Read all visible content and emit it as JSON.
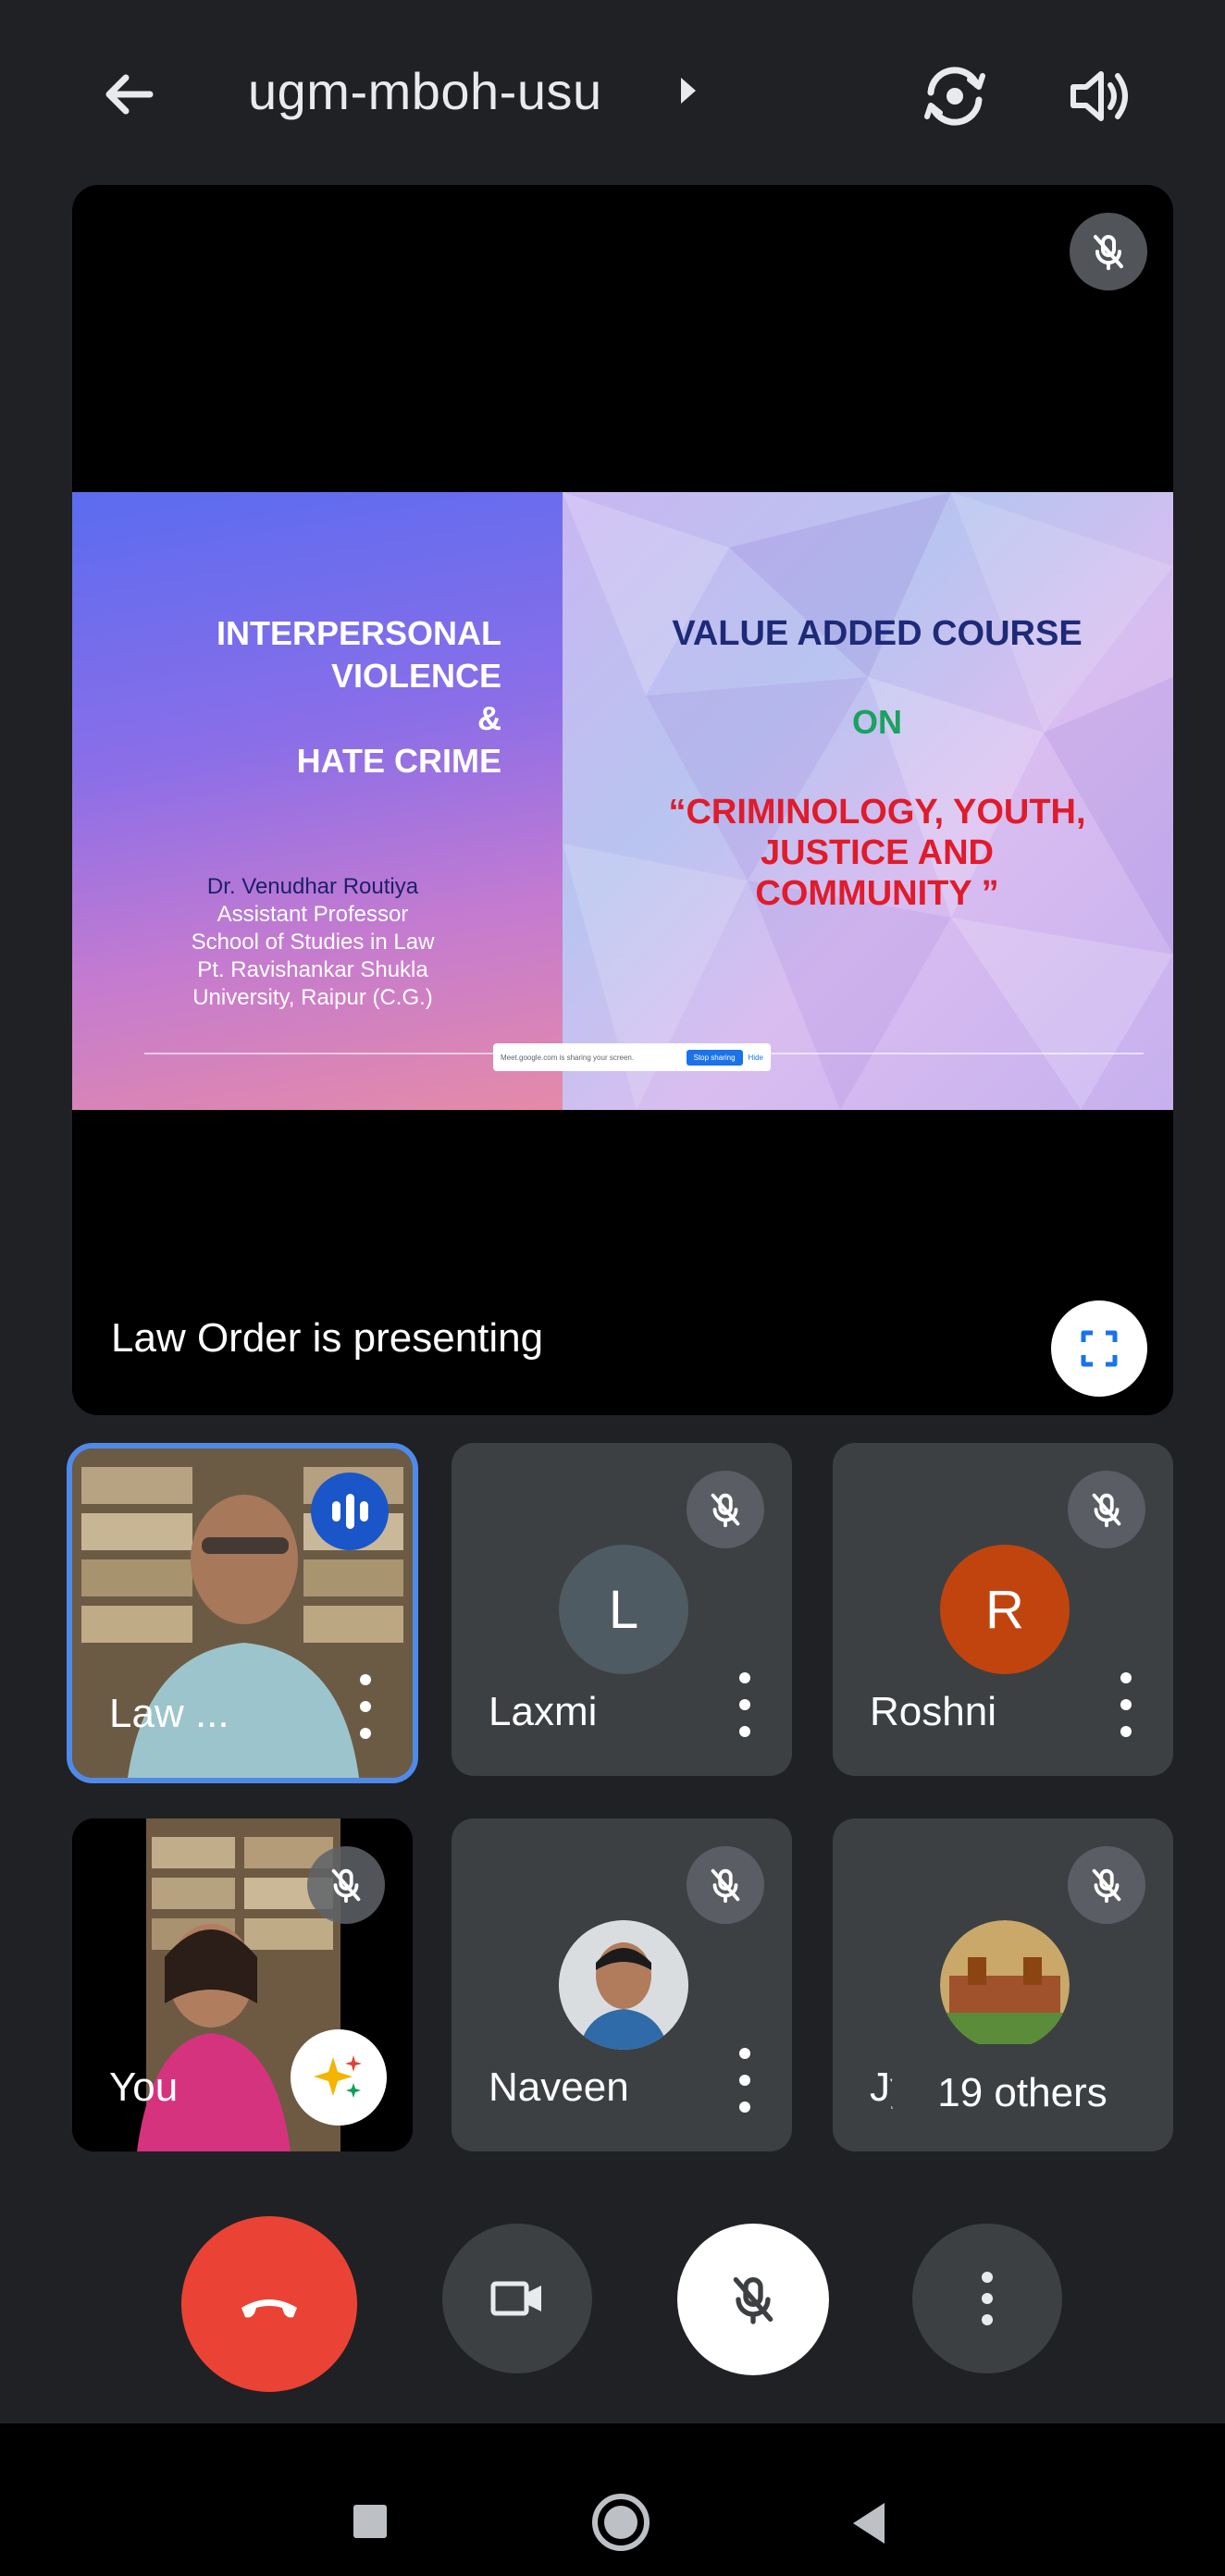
{
  "header": {
    "meeting_code": "ugm-mboh-usu",
    "back_icon": "arrow-left-icon",
    "switch_camera_icon": "camera-switch-icon",
    "speaker_icon": "speaker-volume-icon"
  },
  "presentation": {
    "status_text": "Law Order is presenting",
    "mic_state_icon": "mic-off-icon",
    "fullscreen_icon": "fullscreen-icon",
    "slide": {
      "left_title_line1": "INTERPERSONAL",
      "left_title_line2": "VIOLENCE",
      "left_title_line3": "&",
      "left_title_line4": "HATE CRIME",
      "author_name": "Dr. Venudhar Routiya",
      "author_role": "Assistant Professor",
      "author_dept": "School of Studies in Law",
      "author_univ1": "Pt. Ravishankar Shukla",
      "author_univ2": "University, Raipur (C.G.)",
      "course_title": "VALUE ADDED COURSE",
      "on_label": "ON",
      "subject_line1": "“CRIMINOLOGY, YOUTH,",
      "subject_line2": "JUSTICE AND",
      "subject_line3": "COMMUNITY ”",
      "share_bar_text": "Meet.google.com is sharing your screen.",
      "share_stop_label": "Stop sharing",
      "share_hide_label": "Hide"
    }
  },
  "participants": [
    {
      "name": "Law ...",
      "state": "speaking",
      "speaking_icon": "audio-level-icon"
    },
    {
      "name": "Laxmi",
      "avatar_letter": "L",
      "avatar_color": "#4f5b62",
      "muted": true
    },
    {
      "name": "Roshni",
      "avatar_letter": "R",
      "avatar_color": "#c1440e",
      "muted": true
    },
    {
      "name": "You",
      "muted": true,
      "effects_icon": "sparkle-effects-icon"
    },
    {
      "name": "Naveen",
      "muted": true
    },
    {
      "name": "Jy",
      "muted": true
    }
  ],
  "others_pill": "19 others",
  "controls": {
    "end_call_icon": "phone-hangup-icon",
    "camera_icon": "video-camera-icon",
    "mic_icon": "mic-off-icon",
    "more_icon": "more-vert-icon"
  },
  "colors": {
    "background": "#202124",
    "tile": "#3c4043",
    "end_call": "#ea4335",
    "speaking_blue": "#1a56c8",
    "active_border": "#4f8ae8"
  }
}
